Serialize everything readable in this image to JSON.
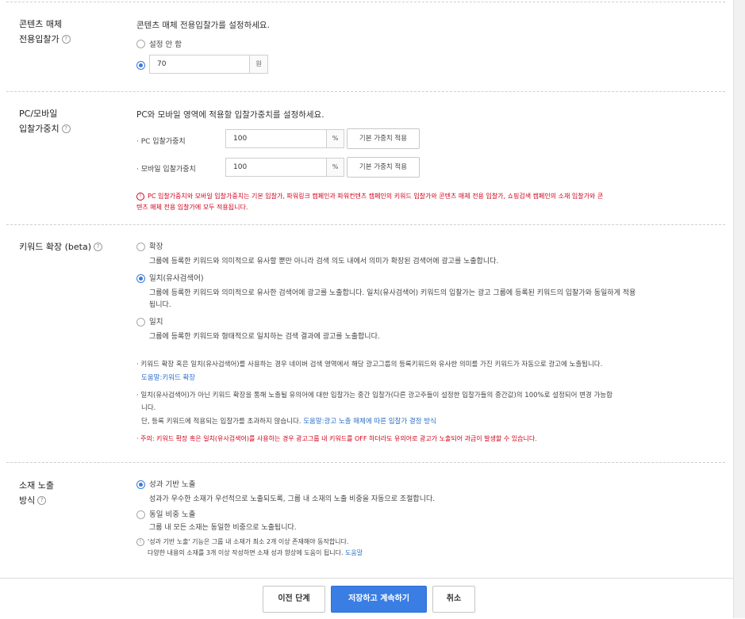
{
  "section_content": {
    "title_line1": "콘텐츠 매체",
    "title_line2": "전용입찰가",
    "description": "콘텐츠 매체 전용입찰가를 설정하세요.",
    "option_unset": "설정 안 함",
    "bid_value": "70",
    "unit": "원"
  },
  "section_weight": {
    "title_line1": "PC/모바일",
    "title_line2": "입찰가중치",
    "description": "PC와 모바일 영역에 적용할 입찰가중치를 설정하세요.",
    "pc_label": "PC 입찰가중치",
    "pc_value": "100",
    "mobile_label": "모바일 입찰가중치",
    "mobile_value": "100",
    "unit": "%",
    "apply_button": "기본 가중치 적용",
    "warning": "PC 입찰가중치와 모바일 입찰가중치는 기본 입찰가, 파워링크 캠페인과 파워컨텐츠 캠페인의 키워드 입찰가와 콘텐츠 매체 전용 입찰가, 쇼핑검색 캠페인의 소재 입찰가와 콘",
    "warning_line2": "텐츠 매체 전용 입찰가에 모두 적용됩니다."
  },
  "section_keyword": {
    "title": "키워드 확장 (beta)",
    "option_expand": "확장",
    "option_expand_desc": "그룹에 등록한 키워드와 의미적으로 유사할 뿐만 아니라 검색 의도 내에서 의미가 확장된 검색어에 광고를 노출합니다.",
    "option_match": "일치(유사검색어)",
    "option_match_desc1": "그룹에 등록한 키워드와 의미적으로 유사한 검색어에 광고를 노출합니다. 일치(유사검색어) 키워드의 입찰가는 광고 그룹에 등록된 키워드의 입찰가와 동일하게 적용",
    "option_match_desc2": "됩니다.",
    "option_exact": "일치",
    "option_exact_desc": "그룹에 등록한 키워드와 형태적으로 일치하는 검색 결과에 광고를 노출합니다.",
    "note1": "키워드 확장 혹은 일치(유사검색어)를 사용하는 경우 네이버 검색 영역에서 해당 광고그룹의 등록키워드와 유사한 의미를 가진 키워드가 자동으로 광고에 노출됩니다.",
    "note1_link": "도움말:키워드 확장",
    "note2": "일치(유사검색어)가 아닌 키워드 확장을 통해 노출될 유의어에 대한 입찰가는 중간 입찰가(다른 광고주들이 설정한 입찰가들의 중간값)의 100%로 설정되어 변경 가능합",
    "note2_line2": "니다.",
    "note2_line3": "단, 등록 키워드에 적용되는 입찰가를 초과하지 않습니다.",
    "note2_link": "도움말:광고 노출 매체에 따른 입찰가 결정 방식",
    "warning": "주의: 키워드 확장 혹은 일치(유사검색어)를 사용하는 경우 광고그룹 내 키워드를 OFF 하더라도 유의어로 광고가 노출되어 과금이 발생할 수 있습니다."
  },
  "section_creative": {
    "title_line1": "소재 노출",
    "title_line2": "방식",
    "option_performance": "성과 기반 노출",
    "option_performance_desc": "성과가 우수한 소재가 우선적으로 노출되도록, 그룹 내 소재의 노출 비중을 자동으로 조절합니다.",
    "option_equal": "동일 비중 노출",
    "option_equal_desc": "그룹 내 모든 소재는 동일한 비중으로 노출됩니다.",
    "info_line1": "'성과 기반 노출' 기능은 그룹 내 소재가 최소 2개 이상 존재해야 동작합니다.",
    "info_line2": "다양한 내용의 소재를 3개 이상 작성하면 소재 성과 향상에 도움이 됩니다.",
    "info_link": "도움말"
  },
  "footer": {
    "prev": "이전 단계",
    "save": "저장하고 계속하기",
    "cancel": "취소"
  },
  "colors": {
    "primary": "#3a7ee4",
    "link": "#2a6fc9",
    "warning": "#d0021b"
  }
}
